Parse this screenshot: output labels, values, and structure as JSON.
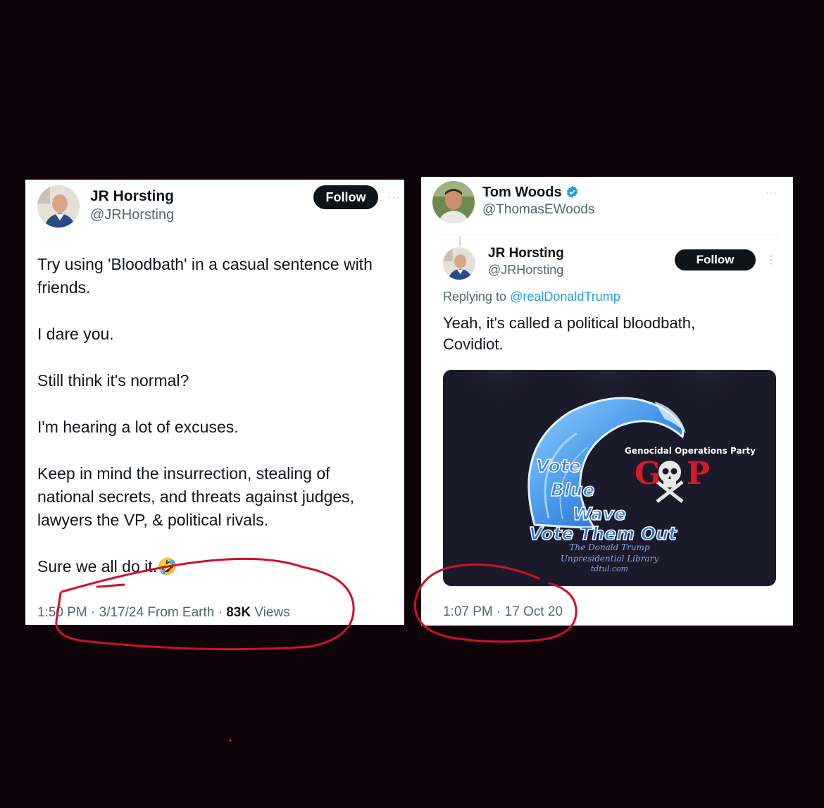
{
  "left_tweet": {
    "name": "JR Horsting",
    "handle": "@JRHorsting",
    "follow_label": "Follow",
    "more_icon": "···",
    "paragraphs": [
      "Try using 'Bloodbath' in a casual sentence with friends.",
      "I dare you.",
      "Still think it's normal?",
      "I'm hearing a lot of excuses.",
      "Keep in mind the insurrection, stealing of national secrets, and threats against judges, lawyers the VP, & political rivals.",
      "Sure we all do it.🤣"
    ],
    "timestamp": "1:50 PM · 3/17/24 From Earth · ",
    "views_count": "83K",
    "views_label": " Views"
  },
  "right_tweet": {
    "name": "Tom Woods",
    "handle": "@ThomasEWoods",
    "more_icon": "···",
    "verified_icon": "verified-badge-icon",
    "quoted": {
      "name": "JR Horsting",
      "handle": "@JRHorsting",
      "follow_label": "Follow",
      "more_icon": "⋮",
      "replying_prefix": "Replying to ",
      "replying_handle": "@realDonaldTrump",
      "text": "Yeah, it's called a political bloodbath, Covidiot.",
      "image": {
        "party_label": "Genocidal Operations Party",
        "gop_left": "G",
        "gop_right": "P",
        "vote": "Vote",
        "blue": "Blue",
        "wave": "Wave",
        "vote_them_out": "Vote Them Out",
        "credit_1": "The Donald Trump",
        "credit_2": "Unpresidential Library",
        "credit_3": "tdtul.com"
      }
    },
    "timestamp": "1:07 PM · 17 Oct 20"
  },
  "colors": {
    "background": "#0d0309",
    "annotation_red": "#d0102a",
    "link_blue": "#1d9bf0",
    "wave_blue": "#3d7fe0",
    "gop_red": "#d9192a"
  }
}
